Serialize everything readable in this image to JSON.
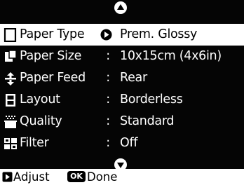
{
  "menu": {
    "items": [
      {
        "label": "Paper Type",
        "value": "Prem. Glossy",
        "icon": "paper-type-icon",
        "selected": true
      },
      {
        "label": "Paper Size",
        "value": "10x15cm (4x6in)",
        "icon": "paper-size-icon"
      },
      {
        "label": "Paper Feed",
        "value": "Rear",
        "icon": "paper-feed-icon"
      },
      {
        "label": "Layout",
        "value": "Borderless",
        "icon": "layout-icon"
      },
      {
        "label": "Quality",
        "value": "Standard",
        "icon": "quality-icon"
      },
      {
        "label": "Filter",
        "value": "Off",
        "icon": "filter-icon"
      }
    ],
    "separator": ":"
  },
  "footer": {
    "adjust_label": "Adjust",
    "ok_badge": "OK",
    "done_label": "Done"
  }
}
